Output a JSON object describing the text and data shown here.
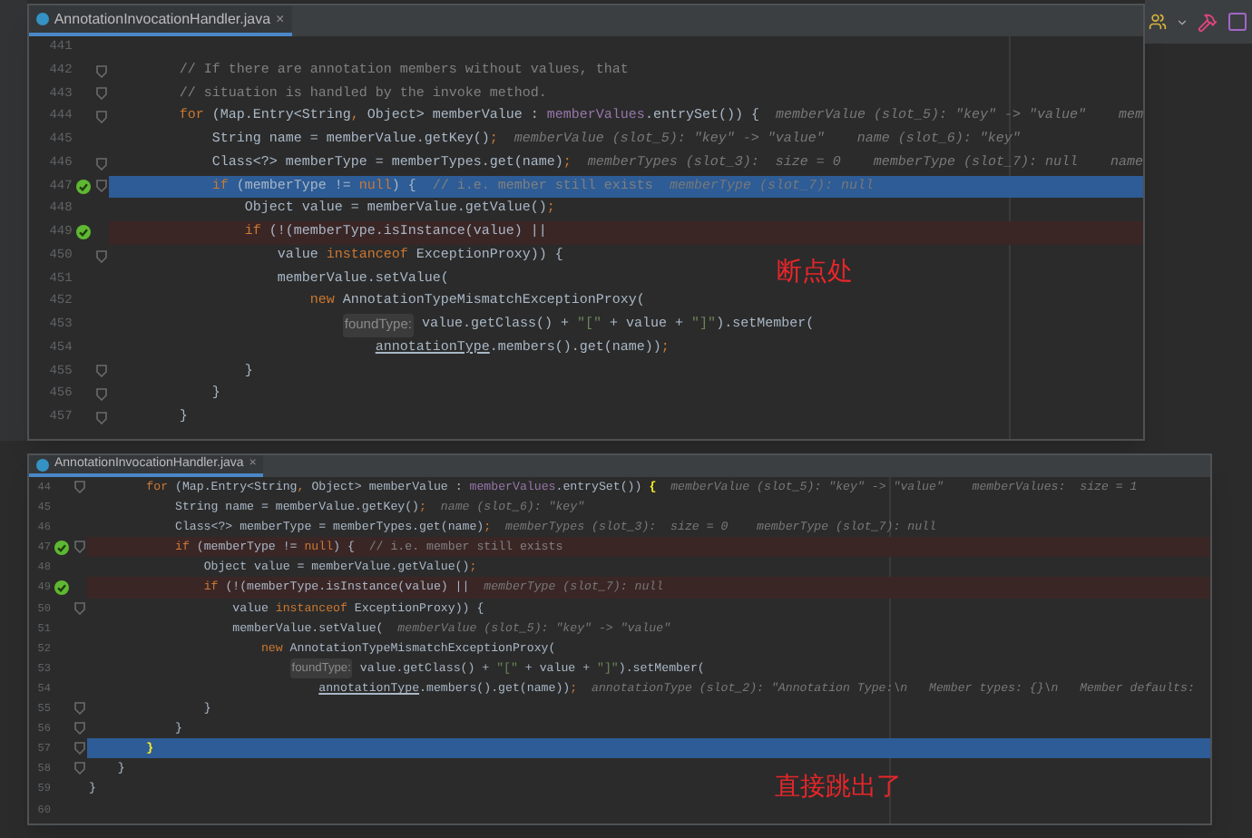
{
  "editors": [
    {
      "tab": {
        "title": "AnnotationInvocationHandler.java",
        "close": "×",
        "selected": true
      },
      "lines": [
        {
          "number": "441",
          "current": false,
          "breakpoint": false,
          "fold": false
        },
        {
          "number": "442",
          "current": false,
          "breakpoint": false,
          "fold": true,
          "code": [
            {
              "kind": "comment",
              "text": "        // If there are annotation members without values, that"
            }
          ]
        },
        {
          "number": "443",
          "current": false,
          "breakpoint": false,
          "fold": true,
          "code": [
            {
              "kind": "comment",
              "text": "        // situation is handled by the invoke method."
            }
          ]
        },
        {
          "number": "444",
          "current": false,
          "breakpoint": false,
          "fold": true,
          "code": [
            {
              "kind": "keyword",
              "text": "        for"
            },
            {
              "kind": "text",
              "text": " (Map.Entry<String"
            },
            {
              "kind": "keyword",
              "text": ","
            },
            {
              "kind": "text",
              "text": " Object> memberValue : "
            },
            {
              "kind": "field",
              "text": "memberValues"
            },
            {
              "kind": "text",
              "text": ".entrySet()) {"
            },
            {
              "kind": "hint",
              "text": "  memberValue (slot_5): \"key\" -> \"value\"    mem"
            }
          ]
        },
        {
          "number": "445",
          "current": false,
          "breakpoint": false,
          "fold": false,
          "code": [
            {
              "kind": "text",
              "text": "            String name = memberValue.getKey()"
            },
            {
              "kind": "keyword",
              "text": ";"
            },
            {
              "kind": "hint",
              "text": "  memberValue (slot_5): \"key\" -> \"value\"    name (slot_6): \"key\""
            }
          ]
        },
        {
          "number": "446",
          "current": false,
          "breakpoint": false,
          "fold": true,
          "code": [
            {
              "kind": "text",
              "text": "            Class<?> memberType = memberTypes.get(name)"
            },
            {
              "kind": "keyword",
              "text": ";"
            },
            {
              "kind": "hint",
              "text": "  memberTypes (slot_3):  size = 0    memberType (slot_7): null    name"
            }
          ]
        },
        {
          "number": "447",
          "current": true,
          "breakpoint": true,
          "fold": true,
          "code": [
            {
              "kind": "keyword",
              "text": "            if"
            },
            {
              "kind": "text",
              "text": " (memberType != "
            },
            {
              "kind": "keyword",
              "text": "null"
            },
            {
              "kind": "text",
              "text": ") {  "
            },
            {
              "kind": "comment",
              "text": "// i.e. member still exists"
            },
            {
              "kind": "hint",
              "text": "  memberType (slot_7): null"
            }
          ]
        },
        {
          "number": "448",
          "current": false,
          "breakpoint": false,
          "fold": false,
          "code": [
            {
              "kind": "text",
              "text": "                Object value = memberValue.getValue()"
            },
            {
              "kind": "keyword",
              "text": ";"
            }
          ]
        },
        {
          "number": "449",
          "current": false,
          "breakpoint": true,
          "fold": false,
          "code": [
            {
              "kind": "keyword",
              "text": "                if"
            },
            {
              "kind": "text",
              "text": " (!(memberType.isInstance(value) ||"
            }
          ]
        },
        {
          "number": "450",
          "current": false,
          "breakpoint": false,
          "fold": true,
          "code": [
            {
              "kind": "text",
              "text": "                    value "
            },
            {
              "kind": "keyword",
              "text": "instanceof"
            },
            {
              "kind": "text",
              "text": " ExceptionProxy)) {"
            }
          ]
        },
        {
          "number": "451",
          "current": false,
          "breakpoint": false,
          "fold": false,
          "code": [
            {
              "kind": "text",
              "text": "                    memberValue.setValue("
            }
          ]
        },
        {
          "number": "452",
          "current": false,
          "breakpoint": false,
          "fold": false,
          "code": [
            {
              "kind": "keyword",
              "text": "                        new"
            },
            {
              "kind": "text",
              "text": " AnnotationTypeMismatchExceptionProxy("
            }
          ]
        },
        {
          "number": "453",
          "current": false,
          "breakpoint": false,
          "fold": false,
          "code": [
            {
              "kind": "param",
              "text": "                            foundType:"
            },
            {
              "kind": "text",
              "text": " value.getClass() + "
            },
            {
              "kind": "string",
              "text": "\"[\""
            },
            {
              "kind": "text",
              "text": " + value + "
            },
            {
              "kind": "string",
              "text": "\"]\""
            },
            {
              "kind": "text",
              "text": ").setMember("
            }
          ]
        },
        {
          "number": "454",
          "current": false,
          "breakpoint": false,
          "fold": false,
          "code": [
            {
              "kind": "underlined",
              "text": "                                annotationType"
            },
            {
              "kind": "text",
              "text": ".members().get(name))"
            },
            {
              "kind": "keyword",
              "text": ";"
            }
          ]
        },
        {
          "number": "455",
          "current": false,
          "breakpoint": false,
          "fold": true,
          "code": [
            {
              "kind": "text",
              "text": "                }"
            }
          ]
        },
        {
          "number": "456",
          "current": false,
          "breakpoint": false,
          "fold": true,
          "code": [
            {
              "kind": "text",
              "text": "            }"
            }
          ]
        },
        {
          "number": "457",
          "current": false,
          "breakpoint": false,
          "fold": true,
          "code": [
            {
              "kind": "text",
              "text": "        }"
            }
          ]
        }
      ]
    },
    {
      "tab": {
        "title": "AnnotationInvocationHandler.java",
        "close": "×",
        "selected": true
      },
      "lines": [
        {
          "number": "44",
          "current": false,
          "breakpoint": false,
          "fold": true,
          "code": [
            {
              "kind": "keyword",
              "text": "        for"
            },
            {
              "kind": "text",
              "text": " (Map.Entry<String"
            },
            {
              "kind": "keyword",
              "text": ","
            },
            {
              "kind": "text",
              "text": " Object> memberValue : "
            },
            {
              "kind": "field",
              "text": "memberValues"
            },
            {
              "kind": "text",
              "text": ".entrySet()) "
            },
            {
              "kind": "match",
              "text": "{"
            },
            {
              "kind": "hint",
              "text": "  memberValue (slot_5): \"key\" -> \"value\"    memberValues:  size = 1"
            }
          ]
        },
        {
          "number": "45",
          "current": false,
          "breakpoint": false,
          "fold": false,
          "code": [
            {
              "kind": "text",
              "text": "            String name = memberValue.getKey()"
            },
            {
              "kind": "keyword",
              "text": ";"
            },
            {
              "kind": "hint",
              "text": "  name (slot_6): \"key\""
            }
          ]
        },
        {
          "number": "46",
          "current": false,
          "breakpoint": false,
          "fold": false,
          "code": [
            {
              "kind": "text",
              "text": "            Class<?> memberType = memberTypes.get(name)"
            },
            {
              "kind": "keyword",
              "text": ";"
            },
            {
              "kind": "hint",
              "text": "  memberTypes (slot_3):  size = 0    memberType (slot_7): null"
            }
          ]
        },
        {
          "number": "47",
          "current": false,
          "breakpoint": true,
          "fold": true,
          "code": [
            {
              "kind": "keyword",
              "text": "            if"
            },
            {
              "kind": "text",
              "text": " (memberType != "
            },
            {
              "kind": "keyword",
              "text": "null"
            },
            {
              "kind": "text",
              "text": ") {  "
            },
            {
              "kind": "comment",
              "text": "// i.e. member still exists"
            }
          ]
        },
        {
          "number": "48",
          "current": false,
          "breakpoint": false,
          "fold": false,
          "code": [
            {
              "kind": "text",
              "text": "                Object value = memberValue.getValue()"
            },
            {
              "kind": "keyword",
              "text": ";"
            }
          ]
        },
        {
          "number": "49",
          "current": false,
          "breakpoint": true,
          "fold": false,
          "code": [
            {
              "kind": "keyword",
              "text": "                if"
            },
            {
              "kind": "text",
              "text": " (!(memberType.isInstance(value) ||"
            },
            {
              "kind": "hint",
              "text": "  memberType (slot_7): null"
            }
          ]
        },
        {
          "number": "50",
          "current": false,
          "breakpoint": false,
          "fold": true,
          "code": [
            {
              "kind": "text",
              "text": "                    value "
            },
            {
              "kind": "keyword",
              "text": "instanceof"
            },
            {
              "kind": "text",
              "text": " ExceptionProxy)) {"
            }
          ]
        },
        {
          "number": "51",
          "current": false,
          "breakpoint": false,
          "fold": false,
          "code": [
            {
              "kind": "text",
              "text": "                    memberValue.setValue("
            },
            {
              "kind": "hint",
              "text": "  memberValue (slot_5): \"key\" -> \"value\""
            }
          ]
        },
        {
          "number": "52",
          "current": false,
          "breakpoint": false,
          "fold": false,
          "code": [
            {
              "kind": "keyword",
              "text": "                        new"
            },
            {
              "kind": "text",
              "text": " AnnotationTypeMismatchExceptionProxy("
            }
          ]
        },
        {
          "number": "53",
          "current": false,
          "breakpoint": false,
          "fold": false,
          "code": [
            {
              "kind": "param",
              "text": "                            foundType:"
            },
            {
              "kind": "text",
              "text": " value.getClass() + "
            },
            {
              "kind": "string",
              "text": "\"[\""
            },
            {
              "kind": "text",
              "text": " + value + "
            },
            {
              "kind": "string",
              "text": "\"]\""
            },
            {
              "kind": "text",
              "text": ").setMember("
            }
          ]
        },
        {
          "number": "54",
          "current": false,
          "breakpoint": false,
          "fold": false,
          "code": [
            {
              "kind": "underlined",
              "text": "                                annotationType"
            },
            {
              "kind": "text",
              "text": ".members().get(name))"
            },
            {
              "kind": "keyword",
              "text": ";"
            },
            {
              "kind": "hint",
              "text": "  annotationType (slot_2): \"Annotation Type:\\n   Member types: {}\\n   Member defaults:"
            }
          ]
        },
        {
          "number": "55",
          "current": false,
          "breakpoint": false,
          "fold": true,
          "code": [
            {
              "kind": "text",
              "text": "                }"
            }
          ]
        },
        {
          "number": "56",
          "current": false,
          "breakpoint": false,
          "fold": true,
          "code": [
            {
              "kind": "text",
              "text": "            }"
            }
          ]
        },
        {
          "number": "57",
          "current": true,
          "breakpoint": false,
          "fold": true,
          "code": [
            {
              "kind": "match",
              "text": "        }"
            }
          ]
        },
        {
          "number": "58",
          "current": false,
          "breakpoint": false,
          "fold": true,
          "code": [
            {
              "kind": "text",
              "text": "    }"
            }
          ]
        },
        {
          "number": "59",
          "current": false,
          "breakpoint": false,
          "fold": false,
          "code": [
            {
              "kind": "text",
              "text": "}"
            }
          ]
        },
        {
          "number": "60",
          "current": false,
          "breakpoint": false,
          "fold": false
        }
      ]
    }
  ],
  "annotations": [
    {
      "text": "断点处"
    },
    {
      "text": "直接跳出了"
    }
  ]
}
